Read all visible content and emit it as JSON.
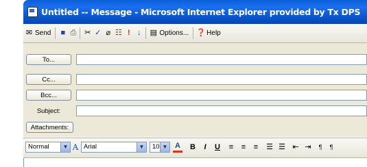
{
  "window": {
    "title": "Untitled -- Message - Microsoft Internet Explorer provided by Tx DPS"
  },
  "toolbar": {
    "send_label": "Send",
    "options_label": "Options...",
    "help_label": "Help",
    "icons": [
      "send-icon",
      "save-icon",
      "print-icon",
      "cut-icon",
      "spelling-icon",
      "attach-icon",
      "address-book-icon",
      "high-importance-icon",
      "low-importance-icon",
      "options-icon",
      "help-icon"
    ]
  },
  "fields": {
    "to_label": "To...",
    "cc_label": "Cc...",
    "bcc_label": "Bcc...",
    "subject_label": "Subject:",
    "attachments_label": "Attachments:",
    "to_value": "",
    "cc_value": "",
    "bcc_value": "",
    "subject_value": ""
  },
  "format": {
    "style": "Normal",
    "font": "Arial",
    "size": "10",
    "bold_label": "B",
    "italic_label": "I",
    "underline_label": "U",
    "font_color_label": "A",
    "accent_underline_color": "#e0301e"
  },
  "colors": {
    "titlebar": "#0a5fd8",
    "panel": "#ece9d8"
  }
}
